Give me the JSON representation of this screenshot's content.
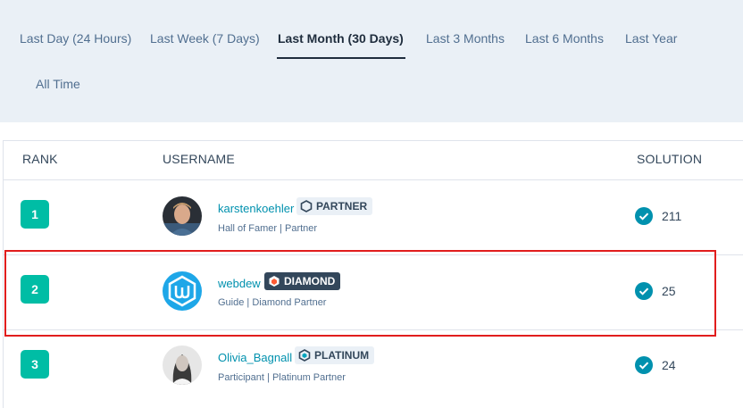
{
  "tabs": [
    {
      "label": "Last Day (24 Hours)"
    },
    {
      "label": "Last Week (7 Days)"
    },
    {
      "label": "Last Month (30 Days)"
    },
    {
      "label": "Last 3 Months"
    },
    {
      "label": "Last 6 Months"
    },
    {
      "label": "Last Year"
    },
    {
      "label": "All Time"
    }
  ],
  "active_tab": "Last Month (30 Days)",
  "table": {
    "headers": {
      "rank": "RANK",
      "username": "USERNAME",
      "solution": "SOLUTION"
    },
    "rows": [
      {
        "rank": "1",
        "username": "karstenkoehler",
        "tier": "PARTNER",
        "tier_style": "light",
        "subtitle": "Hall of Famer | Partner",
        "solutions": "211"
      },
      {
        "rank": "2",
        "username": "webdew",
        "tier": "DIAMOND",
        "tier_style": "dark",
        "subtitle": "Guide | Diamond Partner",
        "solutions": "25"
      },
      {
        "rank": "3",
        "username": "Olivia_Bagnall",
        "tier": "PLATINUM",
        "tier_style": "light",
        "subtitle": "Participant | Platinum Partner",
        "solutions": "24"
      }
    ]
  },
  "colors": {
    "accent_teal": "#00bda5",
    "check_blue": "#0091ae",
    "link": "#0091ae",
    "highlight_red": "#e11d1d"
  }
}
